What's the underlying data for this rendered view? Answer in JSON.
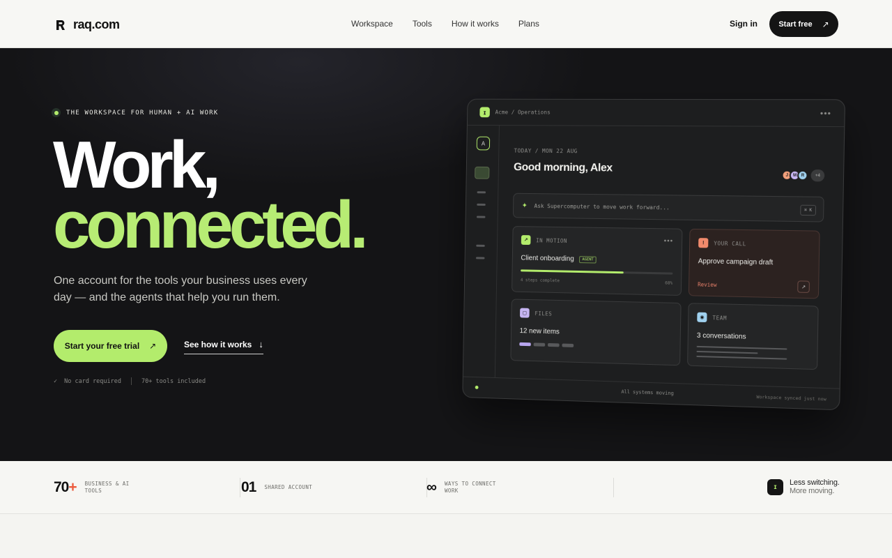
{
  "nav": {
    "brand": "raq.com",
    "links": [
      "Workspace",
      "Tools",
      "How it works",
      "Plans"
    ],
    "signin": "Sign in",
    "start_free": "Start free",
    "arrow": "↗"
  },
  "hero": {
    "eyebrow": "THE WORKSPACE FOR HUMAN + AI WORK",
    "headline_1": "Work,",
    "headline_2": "connected.",
    "subcopy": "One account for the tools your business uses every day — and the agents that help you run them.",
    "cta_primary": "Start your free trial",
    "cta_primary_arrow": "↗",
    "cta_secondary": "See how it works",
    "cta_secondary_arrow": "↓",
    "meta_check": "✓",
    "meta_1": "No card required",
    "meta_2": "70+ tools included",
    "accent": "#b3ec6c"
  },
  "mockup": {
    "ws_icon": "ɪ",
    "breadcrumb": "Acme / Operations",
    "menu_dots": "•••",
    "rail_avatar": "A",
    "date": "TODAY / MON 22 AUG",
    "greeting": "Good morning, Alex",
    "avatars": [
      {
        "initial": "J",
        "color": "#f2a07c"
      },
      {
        "initial": "M",
        "color": "#c6b5f2"
      },
      {
        "initial": "R",
        "color": "#9fd0ee"
      }
    ],
    "avatars_more": "+4",
    "ask_spark": "✦",
    "ask_placeholder": "Ask Supercomputer to move work forward...",
    "ask_shortcut": "⌘ K",
    "card_motion": {
      "icon": "↗",
      "label": "IN MOTION",
      "title": "Client onboarding",
      "badge": "AGENT",
      "dots": "•••",
      "steps": "4 steps complete",
      "percent": "68%",
      "progress": 0.68
    },
    "card_call": {
      "icon": "!",
      "label": "YOUR CALL",
      "title": "Approve campaign draft",
      "action": "Review",
      "action_icon": "↗"
    },
    "card_files": {
      "icon": "▢",
      "label": "FILES",
      "title": "12 new items"
    },
    "card_team": {
      "icon": "◉",
      "label": "TEAM",
      "title": "3 conversations"
    },
    "footer_status": "All systems moving",
    "footer_sync": "Workspace synced just now"
  },
  "stats": {
    "items": [
      {
        "num": "70",
        "suffix": "+",
        "label": "BUSINESS & AI TOOLS"
      },
      {
        "num": "01",
        "suffix": "",
        "label": "SHARED ACCOUNT"
      },
      {
        "num": "∞",
        "suffix": "",
        "label": "WAYS TO CONNECT WORK"
      }
    ],
    "tag_icon": "ɪ",
    "tag_line1": "Less switching.",
    "tag_line2": "More moving."
  }
}
